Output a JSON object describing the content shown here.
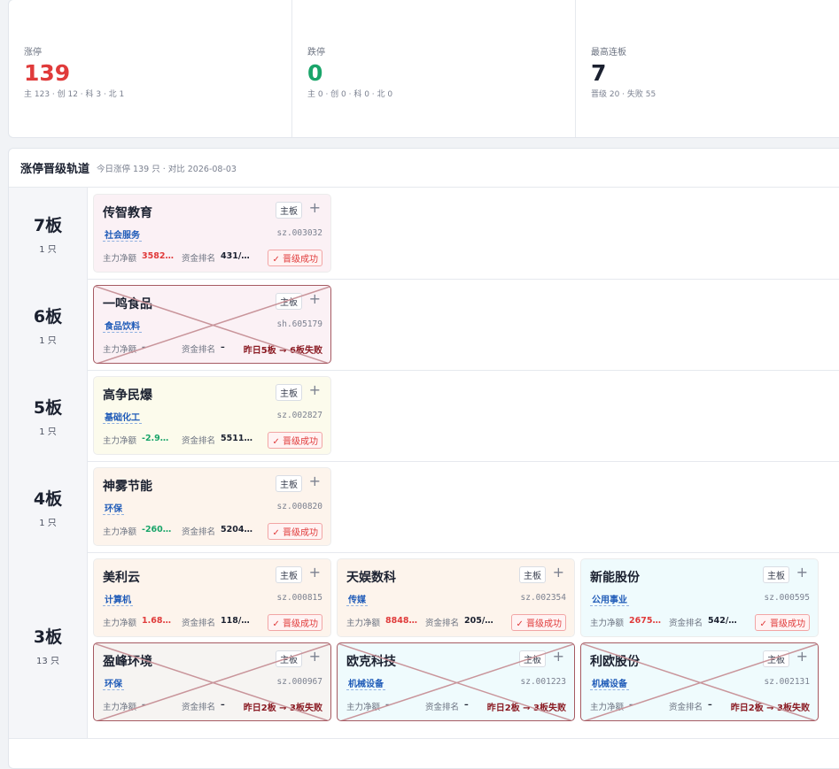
{
  "stats": [
    {
      "label": "涨停",
      "value": "139",
      "sub": "主 123 · 创 12 · 科 3 · 北 1",
      "tone": "red"
    },
    {
      "label": "跌停",
      "value": "0",
      "sub": "主 0 · 创 0 · 科 0 · 北 0",
      "tone": "green"
    },
    {
      "label": "最高连板",
      "value": "7",
      "sub": "晋级 20 · 失败 55",
      "tone": "dark"
    }
  ],
  "panel": {
    "title": "涨停晋级轨道",
    "subtitle": "今日涨停 139 只 · 对比 2026-08-03"
  },
  "tiers": [
    {
      "name": "7板",
      "count": "1 只",
      "cards": [
        {
          "name": "传智教育",
          "tag": "主板",
          "sector": "社会服务",
          "code": "sz.003032",
          "flow_label": "主力净额",
          "flow": "3582…",
          "flow_tone": "red",
          "rank_label": "资金排名",
          "rank": "431/…",
          "status": "ok",
          "badge": "晋级成功",
          "bg": "pink"
        }
      ]
    },
    {
      "name": "6板",
      "count": "1 只",
      "cards": [
        {
          "name": "一鸣食品",
          "tag": "主板",
          "sector": "食品饮料",
          "code": "sh.605179",
          "flow_label": "主力净额",
          "flow": "–",
          "flow_tone": "none",
          "rank_label": "资金排名",
          "rank": "–",
          "status": "fail",
          "badge": "昨日5板 → 6板失败",
          "bg": "pink"
        }
      ]
    },
    {
      "name": "5板",
      "count": "1 只",
      "cards": [
        {
          "name": "高争民爆",
          "tag": "主板",
          "sector": "基础化工",
          "code": "sz.002827",
          "flow_label": "主力净额",
          "flow": "-2.9…",
          "flow_tone": "green",
          "rank_label": "资金排名",
          "rank": "5511…",
          "status": "ok",
          "badge": "晋级成功",
          "bg": "yellow"
        }
      ]
    },
    {
      "name": "4板",
      "count": "1 只",
      "cards": [
        {
          "name": "神雾节能",
          "tag": "主板",
          "sector": "环保",
          "code": "sz.000820",
          "flow_label": "主力净额",
          "flow": "-260…",
          "flow_tone": "green",
          "rank_label": "资金排名",
          "rank": "5204…",
          "status": "ok",
          "badge": "晋级成功",
          "bg": "peach"
        }
      ]
    },
    {
      "name": "3板",
      "count": "13 只",
      "cards": [
        {
          "name": "美利云",
          "tag": "主板",
          "sector": "计算机",
          "code": "sz.000815",
          "flow_label": "主力净额",
          "flow": "1.68…",
          "flow_tone": "red",
          "rank_label": "资金排名",
          "rank": "118/…",
          "status": "ok",
          "badge": "晋级成功",
          "bg": "peach"
        },
        {
          "name": "天娱数科",
          "tag": "主板",
          "sector": "传媒",
          "code": "sz.002354",
          "flow_label": "主力净额",
          "flow": "8848…",
          "flow_tone": "red",
          "rank_label": "资金排名",
          "rank": "205/…",
          "status": "ok",
          "badge": "晋级成功",
          "bg": "peach"
        },
        {
          "name": "新能股份",
          "tag": "主板",
          "sector": "公用事业",
          "code": "sz.000595",
          "flow_label": "主力净额",
          "flow": "2675…",
          "flow_tone": "red",
          "rank_label": "资金排名",
          "rank": "542/…",
          "status": "ok",
          "badge": "晋级成功",
          "bg": "cyan"
        },
        {
          "name": "盈峰环境",
          "tag": "主板",
          "sector": "环保",
          "code": "sz.000967",
          "flow_label": "主力净额",
          "flow": "–",
          "flow_tone": "none",
          "rank_label": "资金排名",
          "rank": "–",
          "status": "fail",
          "badge": "昨日2板 → 3板失败",
          "bg": "gray"
        },
        {
          "name": "欧克科技",
          "tag": "主板",
          "sector": "机械设备",
          "code": "sz.001223",
          "flow_label": "主力净额",
          "flow": "–",
          "flow_tone": "none",
          "rank_label": "资金排名",
          "rank": "–",
          "status": "fail",
          "badge": "昨日2板 → 3板失败",
          "bg": "cyan"
        },
        {
          "name": "利欧股份",
          "tag": "主板",
          "sector": "机械设备",
          "code": "sz.002131",
          "flow_label": "主力净额",
          "flow": "–",
          "flow_tone": "none",
          "rank_label": "资金排名",
          "rank": "–",
          "status": "fail",
          "badge": "昨日2板 → 3板失败",
          "bg": "cyan"
        }
      ]
    }
  ],
  "icons": {
    "add": "plus-icon",
    "check": "check-icon"
  },
  "colors": {
    "up": "#e03b3b",
    "down": "#1aa56a",
    "sector": "#1f5bb8",
    "fail_border": "#a65a62"
  }
}
